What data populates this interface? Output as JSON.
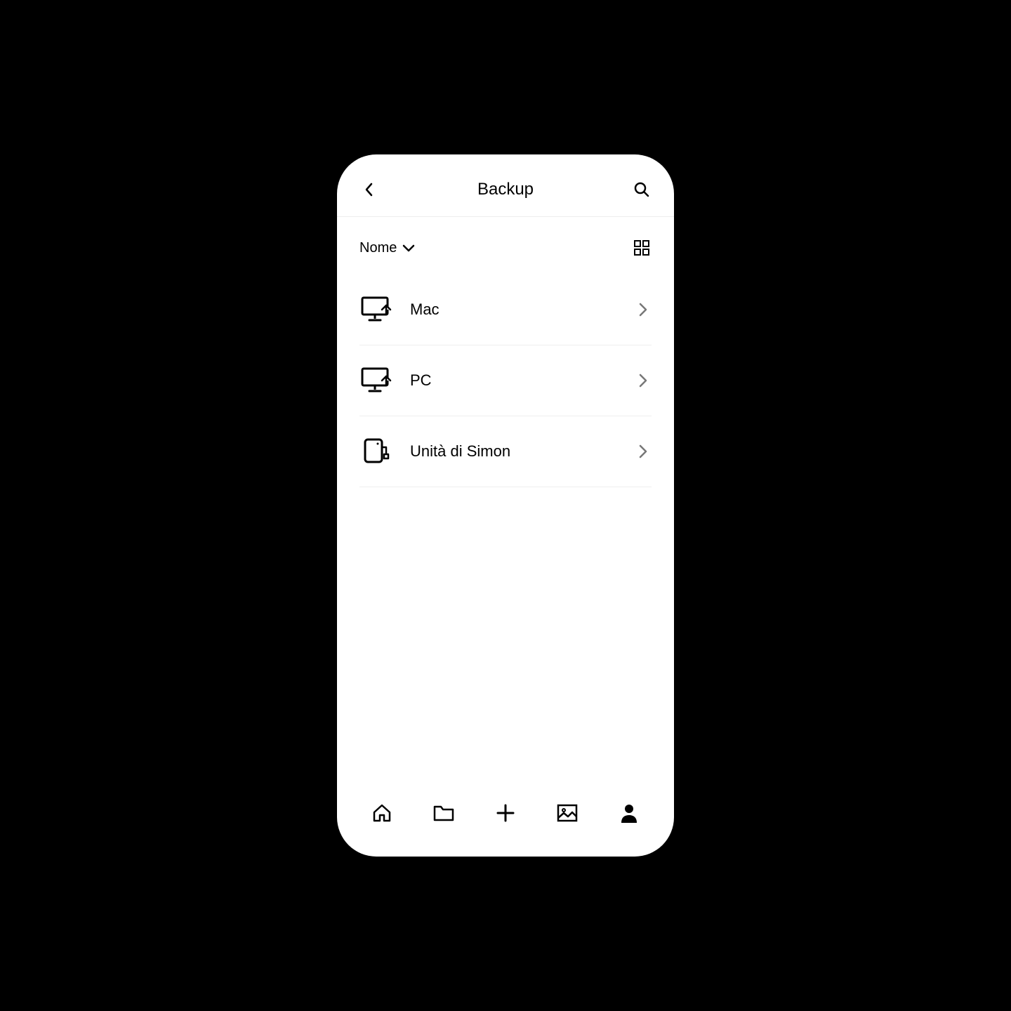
{
  "header": {
    "title": "Backup"
  },
  "sort": {
    "label": "Nome"
  },
  "items": [
    {
      "label": "Mac",
      "icon": "computer"
    },
    {
      "label": "PC",
      "icon": "computer"
    },
    {
      "label": "Unità di Simon",
      "icon": "drive"
    }
  ]
}
